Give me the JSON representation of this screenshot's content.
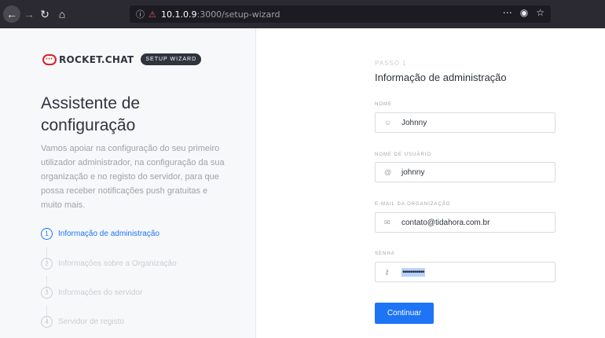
{
  "browser": {
    "url_host": "10.1.0.9",
    "url_path": ":3000/setup-wizard"
  },
  "sidebar": {
    "logo_text": "ROCKET.CHAT",
    "badge": "SETUP WIZARD",
    "title": "Assistente de configuração",
    "description": "Vamos apoiar na configuração do seu primeiro utilizador administrador, na configuração da sua organização e no registo do servidor, para que possa receber notificações push gratuitas e muito mais.",
    "steps": [
      {
        "number": "1",
        "label": "Informação de administração",
        "active": true
      },
      {
        "number": "2",
        "label": "Informações sobre a Organização",
        "active": false
      },
      {
        "number": "3",
        "label": "Informações do servidor",
        "active": false
      },
      {
        "number": "4",
        "label": "Servidor de registo",
        "active": false
      }
    ]
  },
  "form": {
    "step_kicker": "PASSO 1",
    "title": "Informação de administração",
    "fields": {
      "name": {
        "label": "NOME",
        "value": "Johnny"
      },
      "username": {
        "label": "NOME DE USUÁRIO",
        "value": "johnny"
      },
      "email": {
        "label": "E-MAIL DA ORGANIZAÇÃO",
        "value": "contato@tidahora.com.br"
      },
      "password": {
        "label": "SENHA",
        "value": "•••••••••••"
      }
    },
    "continue_label": "Continuar"
  },
  "colors": {
    "accent": "#1d74f5",
    "brand": "#db2323",
    "sidebar_bg": "#f7f8fa"
  }
}
